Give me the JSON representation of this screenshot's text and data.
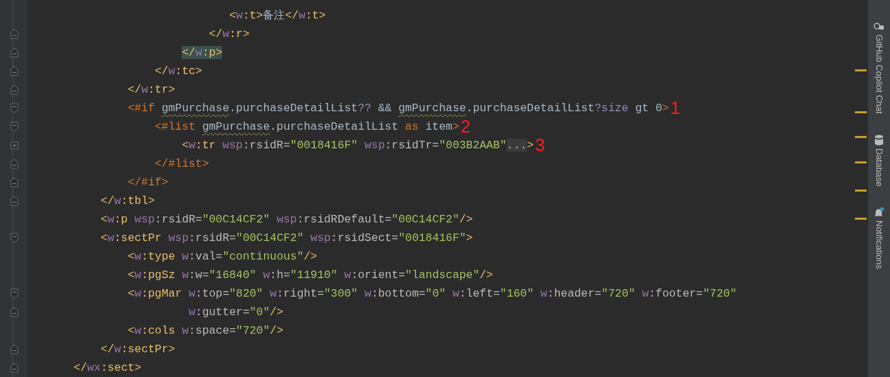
{
  "editor": {
    "lines": [
      {
        "tokens": [
          {
            "kind": "tag",
            "text": "                       <"
          },
          {
            "kind": "ns",
            "text": "w"
          },
          {
            "kind": "tag",
            "text": ":t>"
          },
          {
            "kind": "expr",
            "text": "备注"
          },
          {
            "kind": "tag",
            "text": "</"
          },
          {
            "kind": "ns",
            "text": "w"
          },
          {
            "kind": "tag",
            "text": ":t>"
          }
        ]
      },
      {
        "kind": "end",
        "tokens": [
          {
            "kind": "tag",
            "text": "                    </"
          },
          {
            "kind": "ns",
            "text": "w"
          },
          {
            "kind": "tag",
            "text": ":r>"
          }
        ]
      },
      {
        "kind": "end",
        "highlight": true,
        "tokens": [
          {
            "kind": "tag",
            "text": "                </"
          },
          {
            "kind": "ns",
            "text": "w"
          },
          {
            "kind": "tag",
            "text": ":p>"
          }
        ]
      },
      {
        "kind": "end",
        "tokens": [
          {
            "kind": "tag",
            "text": "            </"
          },
          {
            "kind": "ns",
            "text": "w"
          },
          {
            "kind": "tag",
            "text": ":tc>"
          }
        ]
      },
      {
        "kind": "end",
        "tokens": [
          {
            "kind": "tag",
            "text": "        </"
          },
          {
            "kind": "ns",
            "text": "w"
          },
          {
            "kind": "tag",
            "text": ":tr>"
          }
        ]
      },
      {
        "kind": "start",
        "annotation": "1",
        "tokens": [
          {
            "kind": "ftl",
            "text": "        <#if "
          },
          {
            "kind": "warn",
            "text": "gmPurchase"
          },
          {
            "kind": "expr",
            "text": ".purchaseDetailList"
          },
          {
            "kind": "op",
            "text": "??"
          },
          {
            "kind": "expr",
            "text": " && "
          },
          {
            "kind": "warn",
            "text": "gmPurchase"
          },
          {
            "kind": "expr",
            "text": ".purchaseDetailList"
          },
          {
            "kind": "op",
            "text": "?size"
          },
          {
            "kind": "expr",
            "text": " gt 0"
          },
          {
            "kind": "ftl",
            "text": ">"
          }
        ]
      },
      {
        "kind": "start",
        "annotation": "2",
        "tokens": [
          {
            "kind": "ftl",
            "text": "            <#list "
          },
          {
            "kind": "warn",
            "text": "gmPurchase"
          },
          {
            "kind": "expr",
            "text": ".purchaseDetailList "
          },
          {
            "kind": "ftl",
            "text": "as"
          },
          {
            "kind": "expr",
            "text": " item"
          },
          {
            "kind": "ftl",
            "text": ">"
          }
        ]
      },
      {
        "kind": "collapsed",
        "annotation": "3",
        "tokens": [
          {
            "kind": "tag",
            "text": "                <"
          },
          {
            "kind": "ns",
            "text": "w"
          },
          {
            "kind": "tag",
            "text": ":tr "
          },
          {
            "kind": "ns",
            "text": "wsp"
          },
          {
            "kind": "attr",
            "text": ":rsidR="
          },
          {
            "kind": "str",
            "text": "\"0018416F\" "
          },
          {
            "kind": "ns",
            "text": "wsp"
          },
          {
            "kind": "attr",
            "text": ":rsidTr="
          },
          {
            "kind": "str",
            "text": "\"003B2AAB\""
          },
          {
            "kind": "folded",
            "text": "..."
          },
          {
            "kind": "tag",
            "text": ">"
          }
        ]
      },
      {
        "kind": "end",
        "tokens": [
          {
            "kind": "ftl",
            "text": "            </#list>"
          }
        ]
      },
      {
        "kind": "end",
        "tokens": [
          {
            "kind": "ftl",
            "text": "        </#if>"
          }
        ]
      },
      {
        "kind": "end",
        "tokens": [
          {
            "kind": "tag",
            "text": "    </"
          },
          {
            "kind": "ns",
            "text": "w"
          },
          {
            "kind": "tag",
            "text": ":tbl>"
          }
        ]
      },
      {
        "tokens": [
          {
            "kind": "tag",
            "text": "    <"
          },
          {
            "kind": "ns",
            "text": "w"
          },
          {
            "kind": "tag",
            "text": ":p "
          },
          {
            "kind": "ns",
            "text": "wsp"
          },
          {
            "kind": "attr",
            "text": ":rsidR="
          },
          {
            "kind": "str",
            "text": "\"00C14CF2\" "
          },
          {
            "kind": "ns",
            "text": "wsp"
          },
          {
            "kind": "attr",
            "text": ":rsidRDefault="
          },
          {
            "kind": "str",
            "text": "\"00C14CF2\""
          },
          {
            "kind": "tag",
            "text": "/>"
          }
        ]
      },
      {
        "kind": "start",
        "tokens": [
          {
            "kind": "tag",
            "text": "    <"
          },
          {
            "kind": "ns",
            "text": "w"
          },
          {
            "kind": "tag",
            "text": ":sectPr "
          },
          {
            "kind": "ns",
            "text": "wsp"
          },
          {
            "kind": "attr",
            "text": ":rsidR="
          },
          {
            "kind": "str",
            "text": "\"00C14CF2\" "
          },
          {
            "kind": "ns",
            "text": "wsp"
          },
          {
            "kind": "attr",
            "text": ":rsidSect="
          },
          {
            "kind": "str",
            "text": "\"0018416F\""
          },
          {
            "kind": "tag",
            "text": ">"
          }
        ]
      },
      {
        "tokens": [
          {
            "kind": "tag",
            "text": "        <"
          },
          {
            "kind": "ns",
            "text": "w"
          },
          {
            "kind": "tag",
            "text": ":type "
          },
          {
            "kind": "ns",
            "text": "w"
          },
          {
            "kind": "attr",
            "text": ":val="
          },
          {
            "kind": "str",
            "text": "\"continuous\""
          },
          {
            "kind": "tag",
            "text": "/>"
          }
        ]
      },
      {
        "tokens": [
          {
            "kind": "tag",
            "text": "        <"
          },
          {
            "kind": "ns",
            "text": "w"
          },
          {
            "kind": "tag",
            "text": ":pgSz "
          },
          {
            "kind": "ns",
            "text": "w"
          },
          {
            "kind": "attr",
            "text": ":w="
          },
          {
            "kind": "str",
            "text": "\"16840\" "
          },
          {
            "kind": "ns",
            "text": "w"
          },
          {
            "kind": "attr",
            "text": ":h="
          },
          {
            "kind": "str",
            "text": "\"11910\" "
          },
          {
            "kind": "ns",
            "text": "w"
          },
          {
            "kind": "attr",
            "text": ":orient="
          },
          {
            "kind": "str",
            "text": "\"landscape\""
          },
          {
            "kind": "tag",
            "text": "/>"
          }
        ]
      },
      {
        "kind": "start",
        "tokens": [
          {
            "kind": "tag",
            "text": "        <"
          },
          {
            "kind": "ns",
            "text": "w"
          },
          {
            "kind": "tag",
            "text": ":pgMar "
          },
          {
            "kind": "ns",
            "text": "w"
          },
          {
            "kind": "attr",
            "text": ":top="
          },
          {
            "kind": "str",
            "text": "\"820\" "
          },
          {
            "kind": "ns",
            "text": "w"
          },
          {
            "kind": "attr",
            "text": ":right="
          },
          {
            "kind": "str",
            "text": "\"300\" "
          },
          {
            "kind": "ns",
            "text": "w"
          },
          {
            "kind": "attr",
            "text": ":bottom="
          },
          {
            "kind": "str",
            "text": "\"0\" "
          },
          {
            "kind": "ns",
            "text": "w"
          },
          {
            "kind": "attr",
            "text": ":left="
          },
          {
            "kind": "str",
            "text": "\"160\" "
          },
          {
            "kind": "ns",
            "text": "w"
          },
          {
            "kind": "attr",
            "text": ":header="
          },
          {
            "kind": "str",
            "text": "\"720\" "
          },
          {
            "kind": "ns",
            "text": "w"
          },
          {
            "kind": "attr",
            "text": ":footer="
          },
          {
            "kind": "str",
            "text": "\"720\""
          }
        ]
      },
      {
        "kind": "end",
        "tokens": [
          {
            "kind": "ns",
            "text": "                 w"
          },
          {
            "kind": "attr",
            "text": ":gutter="
          },
          {
            "kind": "str",
            "text": "\"0\""
          },
          {
            "kind": "tag",
            "text": "/>"
          }
        ]
      },
      {
        "tokens": [
          {
            "kind": "tag",
            "text": "        <"
          },
          {
            "kind": "ns",
            "text": "w"
          },
          {
            "kind": "tag",
            "text": ":cols "
          },
          {
            "kind": "ns",
            "text": "w"
          },
          {
            "kind": "attr",
            "text": ":space="
          },
          {
            "kind": "str",
            "text": "\"720\""
          },
          {
            "kind": "tag",
            "text": "/>"
          }
        ]
      },
      {
        "kind": "end",
        "tokens": [
          {
            "kind": "tag",
            "text": "    </"
          },
          {
            "kind": "ns",
            "text": "w"
          },
          {
            "kind": "tag",
            "text": ":sectPr>"
          }
        ]
      },
      {
        "kind": "end",
        "tokens": [
          {
            "kind": "tag",
            "text": "</"
          },
          {
            "kind": "ns",
            "text": "wx"
          },
          {
            "kind": "tag",
            "text": ":sect>"
          }
        ]
      }
    ]
  },
  "tool_strip": [
    {
      "kind": "copilot",
      "label": "GitHub Copilot Chat"
    },
    {
      "kind": "database",
      "label": "Database"
    },
    {
      "kind": "notifications",
      "label": "Notifications"
    }
  ]
}
